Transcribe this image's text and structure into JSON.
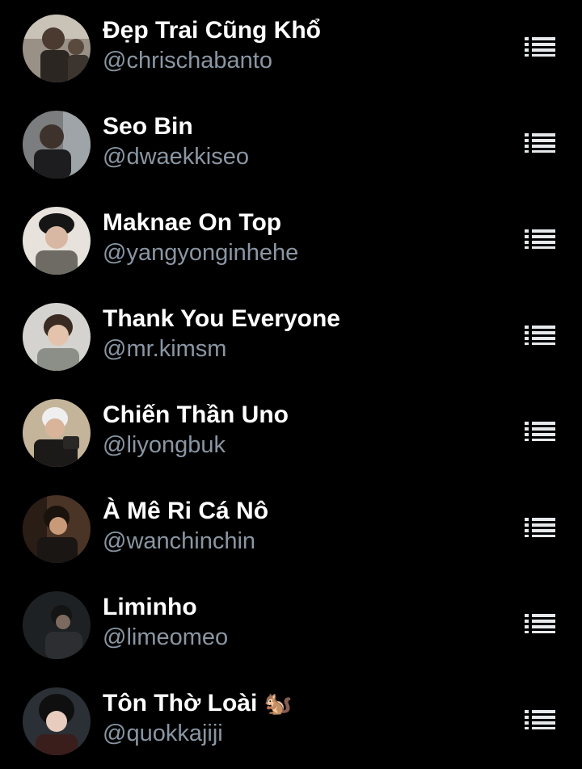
{
  "members": [
    {
      "name": "Đẹp Trai Cũng Khổ",
      "handle": "@chrischabanto",
      "menu_icon": "list-icon"
    },
    {
      "name": "Seo Bin",
      "handle": "@dwaekkiseo",
      "menu_icon": "list-icon"
    },
    {
      "name": "Maknae On Top",
      "handle": "@yangyonginhehe",
      "menu_icon": "list-icon"
    },
    {
      "name": "Thank You Everyone",
      "handle": "@mr.kimsm",
      "menu_icon": "list-icon"
    },
    {
      "name": "Chiến Thần Uno",
      "handle": "@liyongbuk",
      "menu_icon": "list-icon"
    },
    {
      "name": "À Mê Ri Cá Nô",
      "handle": "@wanchinchin",
      "menu_icon": "list-icon"
    },
    {
      "name": "Liminho",
      "handle": "@limeomeo",
      "menu_icon": "list-icon"
    },
    {
      "name": "Tôn Thờ Loài",
      "name_emoji": "🐿️",
      "handle": "@quokkajiji",
      "menu_icon": "list-icon"
    }
  ],
  "colors": {
    "background": "#000000",
    "name_text": "#ffffff",
    "handle_text": "#8a96a3",
    "icon": "#e6e9ec"
  }
}
